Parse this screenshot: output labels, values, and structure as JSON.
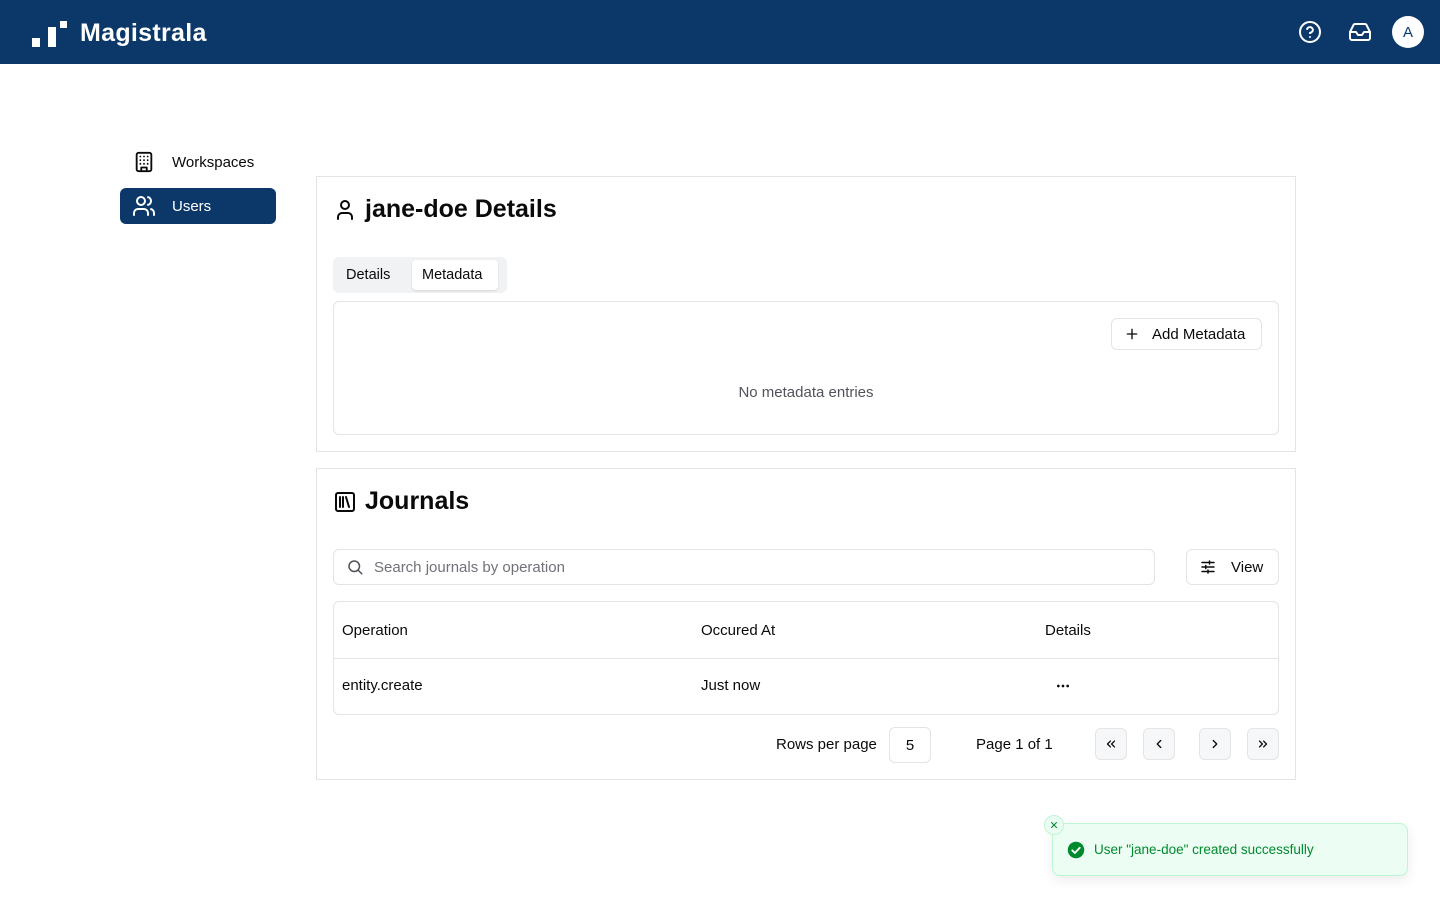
{
  "app": {
    "name": "Magistrala",
    "avatar_initial": "A",
    "brand_color": "#0b3869"
  },
  "header_icons": [
    "help-circle-icon",
    "inbox-icon"
  ],
  "sidebar": {
    "items": [
      {
        "label": "Workspaces",
        "icon": "building-icon",
        "active": false
      },
      {
        "label": "Users",
        "icon": "users-icon",
        "active": true
      }
    ]
  },
  "user_card": {
    "title": "jane-doe Details",
    "icon": "user-icon",
    "tabs": [
      {
        "label": "Details",
        "active": false
      },
      {
        "label": "Metadata",
        "active": true
      }
    ],
    "add_metadata_label": "Add Metadata",
    "empty_message": "No metadata entries"
  },
  "journals": {
    "title": "Journals",
    "icon": "journal-icon",
    "search_placeholder": "Search journals by operation",
    "view_label": "View",
    "columns": [
      "Operation",
      "Occured At",
      "Details"
    ],
    "rows": [
      {
        "operation": "entity.create",
        "occurred_at": "Just now"
      }
    ],
    "pagination": {
      "rows_per_page_label": "Rows per page",
      "rows_per_page": "5",
      "page_info": "Page 1 of 1"
    }
  },
  "toast": {
    "message": "User \"jane-doe\" created successfully",
    "status_color": "#008a2e"
  }
}
